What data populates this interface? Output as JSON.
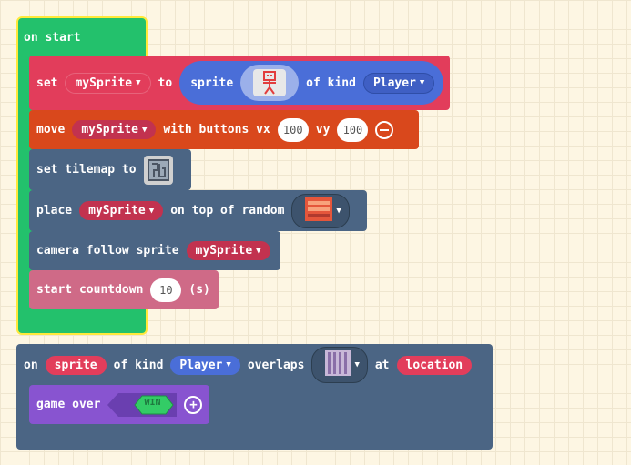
{
  "on_start": {
    "header": "on start",
    "set_block": {
      "set_label": "set",
      "var": "mySprite",
      "to_label": "to",
      "sprite_label": "sprite",
      "of_kind_label": "of kind",
      "kind": "Player"
    },
    "move_block": {
      "move_label": "move",
      "var": "mySprite",
      "with_label": "with buttons vx",
      "vx": "100",
      "vy_label": "vy",
      "vy": "100"
    },
    "tilemap_block": {
      "label": "set tilemap to"
    },
    "place_block": {
      "place_label": "place",
      "var": "mySprite",
      "top_label": "on top of random"
    },
    "camera_block": {
      "label": "camera follow sprite",
      "var": "mySprite"
    },
    "countdown_block": {
      "label": "start countdown",
      "value": "10",
      "unit": "(s)"
    }
  },
  "overlap_event": {
    "on_label": "on",
    "sprite_var": "sprite",
    "of_kind_label": "of kind",
    "kind": "Player",
    "overlaps_label": "overlaps",
    "at_label": "at",
    "location_var": "location",
    "game_over": {
      "label": "game over",
      "win": "WIN"
    }
  },
  "colors": {
    "event_green": "#23c16c",
    "sprites_red": "#e23d5b",
    "controller_orange": "#d9481c",
    "scene_blue": "#4b6584",
    "info_pink": "#cf6a87",
    "game_purple": "#8854d0",
    "kind_blue": "#4a6ed8",
    "selected_outline": "#ffe93b"
  }
}
